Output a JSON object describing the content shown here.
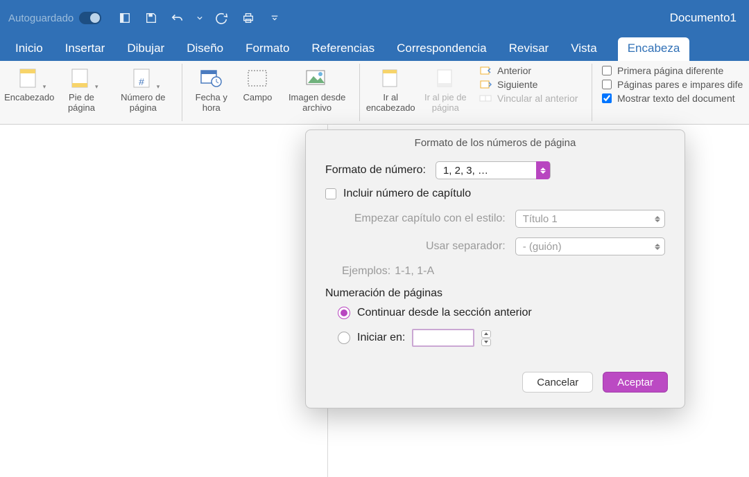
{
  "titlebar": {
    "autosave": "Autoguardado",
    "document": "Documento1"
  },
  "menu": {
    "items": [
      "Inicio",
      "Insertar",
      "Dibujar",
      "Diseño",
      "Formato",
      "Referencias",
      "Correspondencia",
      "Revisar",
      "Vista",
      "Encabeza"
    ],
    "active_index": 9
  },
  "ribbon": {
    "header": "Encabezado",
    "footer": "Pie de página",
    "pagenum": "Número de página",
    "datetime": "Fecha y hora",
    "field": "Campo",
    "image_file": "Imagen desde archivo",
    "goto_header": "Ir al encabezado",
    "goto_footer": "Ir al pie de página",
    "nav": {
      "prev": "Anterior",
      "next": "Siguiente",
      "link_prev": "Vincular al anterior"
    },
    "options": {
      "diff_first": "Primera página diferente",
      "diff_odd_even": "Páginas pares e impares dife",
      "show_doc": "Mostrar texto del document"
    }
  },
  "dialog": {
    "title": "Formato de los números de página",
    "num_format_label": "Formato de número:",
    "num_format_value": "1, 2, 3, …",
    "include_chapter": "Incluir número de capítulo",
    "chapter_style_label": "Empezar capítulo con el estilo:",
    "chapter_style_value": "Título 1",
    "separator_label": "Usar separador:",
    "separator_value": "-    (guión)",
    "examples_label": "Ejemplos:",
    "examples_value": "1-1, 1-A",
    "numbering_section": "Numeración de páginas",
    "continue_prev": "Continuar desde la sección anterior",
    "start_at": "Iniciar en:",
    "start_at_value": "",
    "cancel": "Cancelar",
    "accept": "Aceptar"
  }
}
